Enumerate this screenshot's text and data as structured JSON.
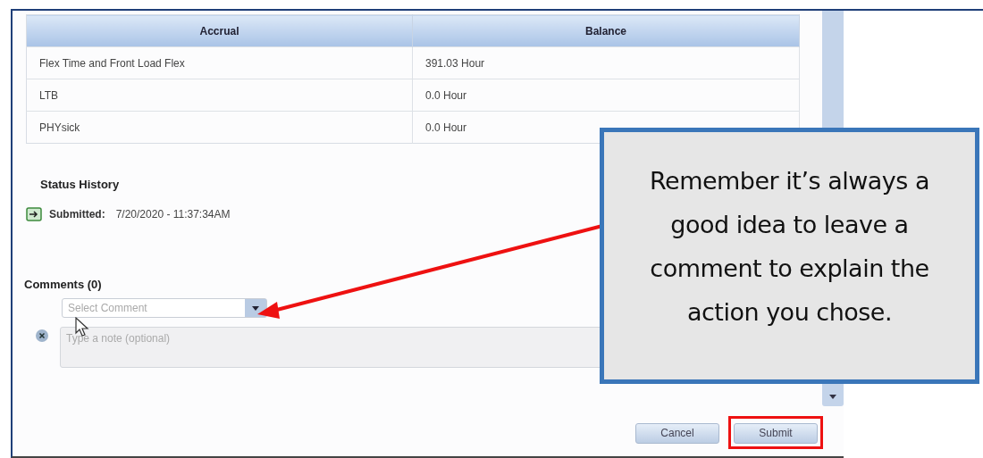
{
  "table": {
    "columns": [
      "Accrual",
      "Balance"
    ],
    "rows": [
      [
        "Flex Time and Front Load Flex",
        "391.03 Hour"
      ],
      [
        "LTB",
        "0.0 Hour"
      ],
      [
        "PHYsick",
        "0.0 Hour"
      ]
    ]
  },
  "status_history": {
    "title": "Status History",
    "entries": [
      {
        "status": "Submitted:",
        "time": "7/20/2020 - 11:37:34AM"
      }
    ]
  },
  "comments": {
    "title": "Comments (0)",
    "select": {
      "placeholder": "Select Comment"
    },
    "note": {
      "placeholder": "Type a note (optional)"
    }
  },
  "buttons": [
    {
      "label": "Cancel",
      "highlighted": false
    },
    {
      "label": "Submit",
      "highlighted": true
    }
  ],
  "callout": {
    "text": "Remember it’s always a good idea to leave a comment to explain the action you chose."
  }
}
